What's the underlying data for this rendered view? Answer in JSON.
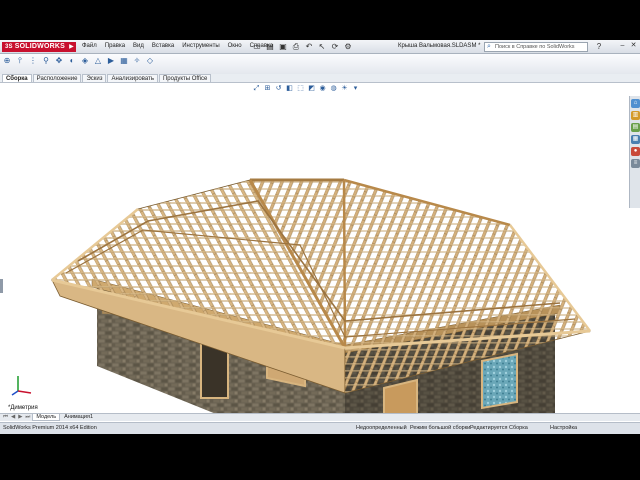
{
  "app": {
    "logo_text": "SOLIDWORKS",
    "logo_prefix": "3S",
    "file_title": "Крыша Вальмовая.SLDASM *",
    "menu": [
      "Файл",
      "Правка",
      "Вид",
      "Вставка",
      "Инструменты",
      "Окно",
      "Справка"
    ]
  },
  "search": {
    "placeholder": "Поиск в Справке по SolidWorks"
  },
  "tabs": [
    "Сборка",
    "Расположение",
    "Эскиз",
    "Анализировать",
    "Продукты Office"
  ],
  "active_tab": "Сборка",
  "viewport": {
    "view_orientation": "*Диметрия"
  },
  "bottom_tabs": [
    "Модель",
    "Анимация1"
  ],
  "statusbar": {
    "edition": "SolidWorks Premium 2014 x64 Edition",
    "definition": "Недоопределенный",
    "mode": "Режим большой сборки",
    "editing": "Редактируется Сборка",
    "units": "Настройка"
  },
  "colors": {
    "brand": "#c8102e",
    "stone": "#5e5748",
    "timber": "#d9b784",
    "window_glass": "#6aa7b8"
  },
  "icons": {
    "quick_access": [
      "new-icon",
      "open-icon",
      "save-icon",
      "print-icon",
      "undo-icon",
      "select-icon",
      "rebuild-icon",
      "options-icon"
    ],
    "command": [
      "insert-component-icon",
      "mate-icon",
      "linear-pattern-icon",
      "smart-fasteners-icon",
      "move-component-icon",
      "show-hidden-icon",
      "assembly-features-icon",
      "reference-geometry-icon",
      "new-motion-icon",
      "bill-of-materials-icon",
      "exploded-view-icon",
      "instant3d-icon"
    ],
    "view": [
      "zoom-to-fit-icon",
      "zoom-area-icon",
      "previous-view-icon",
      "section-view-icon",
      "view-orientation-icon",
      "display-style-icon",
      "hide-show-icon",
      "edit-appearance-icon",
      "scene-icon",
      "view-settings-icon"
    ],
    "task_pane": [
      "resources-icon",
      "design-library-icon",
      "file-explorer-icon",
      "view-palette-icon",
      "appearances-icon",
      "custom-properties-icon"
    ]
  }
}
